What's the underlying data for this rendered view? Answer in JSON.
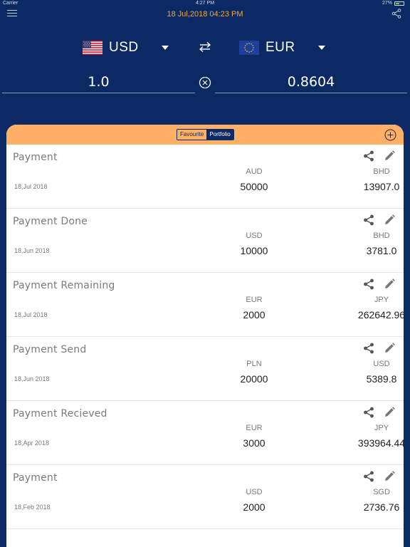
{
  "status_bar": {
    "carrier": "Carrier",
    "time": "4:27 PM",
    "battery": "27%"
  },
  "header": {
    "datetime": "18 Jul,2018 04:23 PM"
  },
  "converter": {
    "from_currency": "USD",
    "to_currency": "EUR",
    "from_amount": "1.0",
    "to_amount": "0.8604"
  },
  "segmented": {
    "favourite_label": "Favourite",
    "portfolio_label": "Portfolio",
    "selected": "Portfolio"
  },
  "transactions": [
    {
      "title": "Payment",
      "date": "18,Jul 2018",
      "from_currency": "AUD",
      "from_amount": "50000",
      "to_currency": "BHD",
      "to_amount": "13907.0"
    },
    {
      "title": "Payment Done",
      "date": "18,Jun 2018",
      "from_currency": "USD",
      "from_amount": "10000",
      "to_currency": "BHD",
      "to_amount": "3781.0"
    },
    {
      "title": "Payment Remaining",
      "date": "18,Jul 2018",
      "from_currency": "EUR",
      "from_amount": "2000",
      "to_currency": "JPY",
      "to_amount": "262642.96"
    },
    {
      "title": "Payment Send",
      "date": "18,Jun 2018",
      "from_currency": "PLN",
      "from_amount": "20000",
      "to_currency": "USD",
      "to_amount": "5389.8"
    },
    {
      "title": "Payment Recieved",
      "date": "18,Apr 2018",
      "from_currency": "EUR",
      "from_amount": "3000",
      "to_currency": "JPY",
      "to_amount": "393964.44"
    },
    {
      "title": "Payment",
      "date": "18,Feb 2018",
      "from_currency": "USD",
      "from_amount": "2000",
      "to_currency": "SGD",
      "to_amount": "2736.76"
    }
  ],
  "icons": {
    "menu": "menu-icon",
    "share": "share-icon",
    "swap": "swap-icon",
    "clear": "clear-circle-icon",
    "add": "add-circle-icon",
    "edit": "pencil-icon",
    "dropdown": "caret-down-icon"
  },
  "colors": {
    "navy": "#0b2a63",
    "orange_header": "#ffb066",
    "datetime_orange": "#f5a83a"
  }
}
